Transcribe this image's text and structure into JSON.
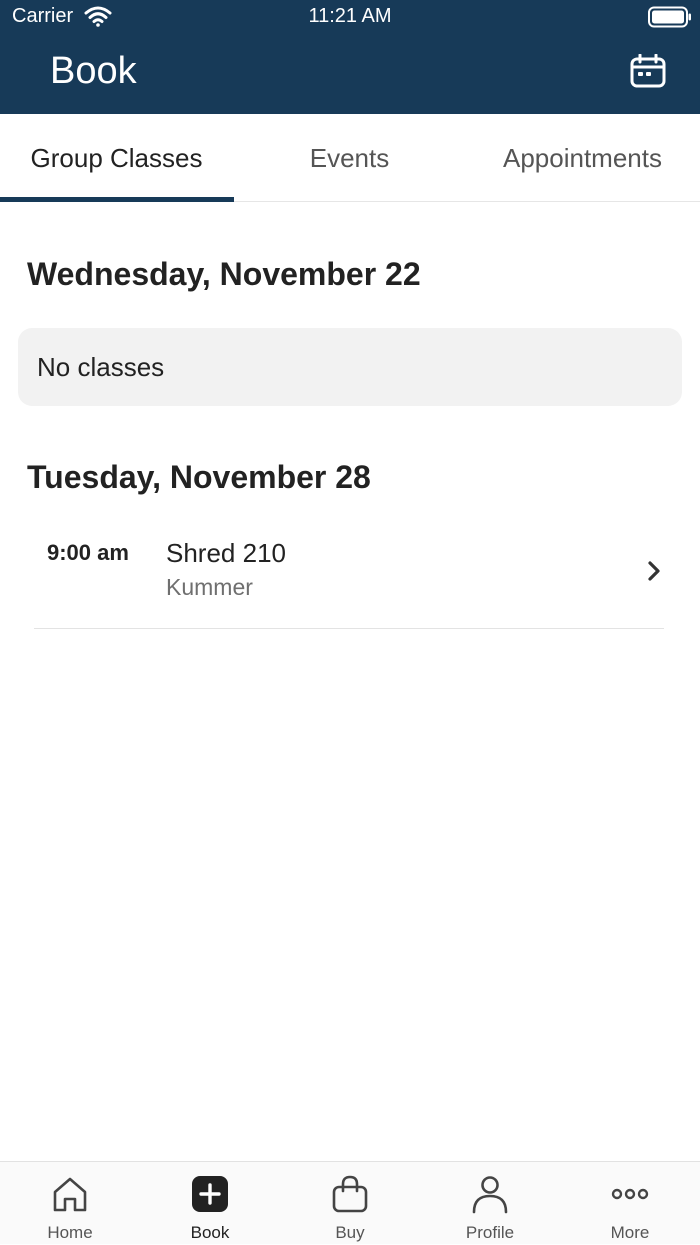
{
  "status_bar": {
    "carrier": "Carrier",
    "time": "11:21 AM"
  },
  "header": {
    "title": "Book",
    "calendar_icon": "calendar-icon"
  },
  "tabs": [
    {
      "label": "Group Classes",
      "active": true
    },
    {
      "label": "Events",
      "active": false
    },
    {
      "label": "Appointments",
      "active": false
    }
  ],
  "days": [
    {
      "heading": "Wednesday, November 22",
      "empty_text": "No classes"
    },
    {
      "heading": "Tuesday, November 28",
      "classes": [
        {
          "time": "9:00 am",
          "name": "Shred 210",
          "instructor": "Kummer"
        }
      ]
    }
  ],
  "tabbar": {
    "items": [
      {
        "label": "Home",
        "icon": "home-icon"
      },
      {
        "label": "Book",
        "icon": "plus-square-icon",
        "active": true
      },
      {
        "label": "Buy",
        "icon": "shopping-bag-icon"
      },
      {
        "label": "Profile",
        "icon": "person-icon"
      },
      {
        "label": "More",
        "icon": "more-dots-icon"
      }
    ]
  },
  "colors": {
    "header_bg": "#173a58",
    "tab_indicator": "#173a58",
    "card_bg": "#f2f2f2"
  }
}
